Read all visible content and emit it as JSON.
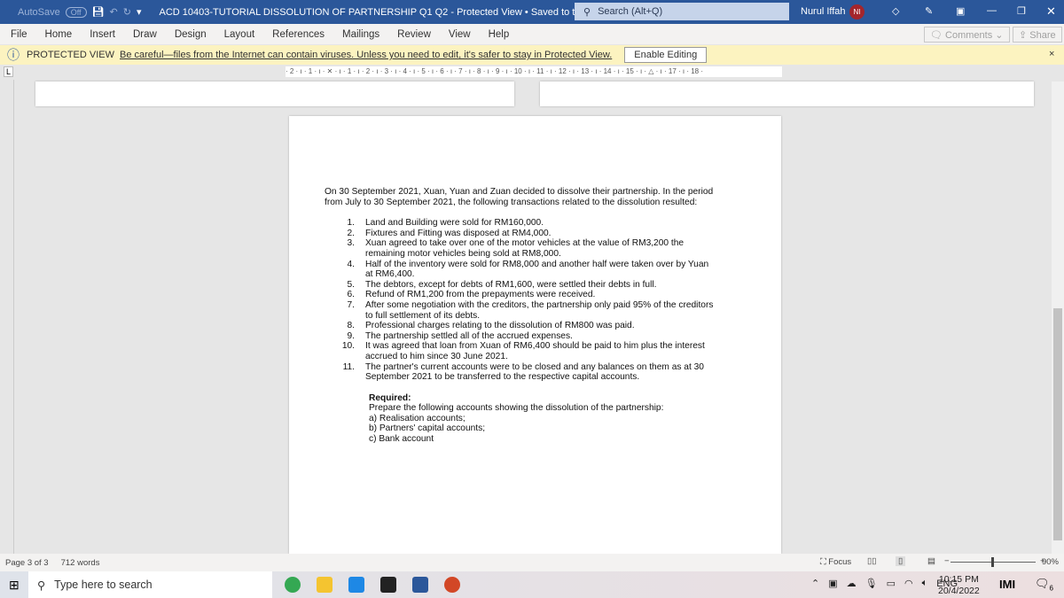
{
  "titlebar": {
    "autosave": "AutoSave",
    "autosave_state": "Off",
    "doc_title": "ACD 10403-TUTORIAL DISSOLUTION OF PARTNERSHIP Q1  Q2  -  Protected View • Saved to this PC",
    "search_placeholder": "Search (Alt+Q)",
    "user": "Nurul Iffah",
    "initials": "NI"
  },
  "menu": {
    "items": [
      "File",
      "Home",
      "Insert",
      "Draw",
      "Design",
      "Layout",
      "References",
      "Mailings",
      "Review",
      "View",
      "Help"
    ],
    "comments": "Comments",
    "share": "Share"
  },
  "protected": {
    "label": "PROTECTED VIEW",
    "message": "Be careful—files from the Internet can contain viruses. Unless you need to edit, it's safer to stay in Protected View.",
    "enable": "Enable Editing",
    "close": "×"
  },
  "ruler": "· 2 · ı · 1 · ı · ✕ · ı · 1 · ı · 2 · ı · 3 · ı · 4 · ı · 5 · ı · 6 · ı · 7 · ı · 8 · ı · 9 · ı · 10 · ı · 11 · ı · 12 · ı · 13 · ı · 14 · ı · 15 · ı · △ · ı · 17 · ı · 18 ·",
  "document": {
    "intro": "On 30 September 2021, Xuan, Yuan and Zuan decided to dissolve their partnership. In the period from July to 30 September 2021, the following transactions related to the dissolution resulted:",
    "items": [
      {
        "n": "1.",
        "t": "Land and Building were sold for RM160,000."
      },
      {
        "n": "2.",
        "t": "Fixtures and Fitting was disposed at RM4,000."
      },
      {
        "n": "3.",
        "t": "Xuan agreed to take over one of the motor vehicles at the value of RM3,200 the remaining motor vehicles being sold at RM8,000."
      },
      {
        "n": "4.",
        "t": "Half of the inventory were sold for RM8,000 and another half were taken over by Yuan at RM6,400."
      },
      {
        "n": "5.",
        "t": "The debtors, except for debts of RM1,600, were settled their debts in full."
      },
      {
        "n": "6.",
        "t": "Refund of RM1,200 from the prepayments were received."
      },
      {
        "n": "7.",
        "t": "After some negotiation with the creditors, the partnership only paid 95% of the creditors to full settlement of its debts."
      },
      {
        "n": "8.",
        "t": "Professional charges relating to the dissolution of RM800 was paid."
      },
      {
        "n": "9.",
        "t": "The partnership settled all of the accrued expenses."
      },
      {
        "n": "10.",
        "t": "It was agreed that loan from Xuan of RM6,400 should be paid to him plus the interest accrued to him since 30 June 2021."
      },
      {
        "n": "11.",
        "t": "The partner's current accounts were to be closed and any balances on them as at 30 September 2021 to be transferred to the respective capital accounts."
      }
    ],
    "required": "Required:",
    "prepare": "Prepare the following accounts showing the dissolution of the partnership:",
    "parts": [
      "a)  Realisation accounts;",
      "b)  Partners' capital accounts;",
      "c)  Bank account"
    ]
  },
  "status": {
    "page": "Page 3 of 3",
    "words": "712 words",
    "focus": "Focus",
    "zoom": "90%",
    "zoom_level": 90
  },
  "taskbar": {
    "search_placeholder": "Type here to search",
    "lang": "ENG",
    "time": "10:15 PM",
    "date": "20/4/2022",
    "notifications": "6"
  }
}
